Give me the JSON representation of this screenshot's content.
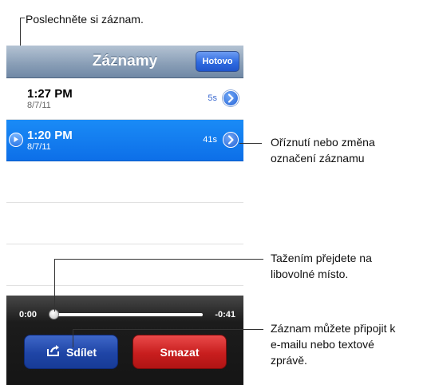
{
  "callouts": {
    "listen": "Poslechněte si záznam.",
    "trim": [
      "Oříznutí nebo změna",
      "označení záznamu"
    ],
    "scrub": [
      "Tažením přejdete na",
      "libovolné místo."
    ],
    "share": [
      "Záznam můžete připojit k",
      "e-mailu nebo textové",
      "zprávě."
    ]
  },
  "navbar": {
    "title": "Záznamy",
    "done_label": "Hotovo"
  },
  "recordings": [
    {
      "time": "1:27 PM",
      "date": "8/7/11",
      "duration": "5s",
      "selected": false
    },
    {
      "time": "1:20 PM",
      "date": "8/7/11",
      "duration": "41s",
      "selected": true
    }
  ],
  "player": {
    "elapsed": "0:00",
    "remaining": "-0:41",
    "progress": 0.0
  },
  "buttons": {
    "share_label": "Sdílet",
    "delete_label": "Smazat"
  },
  "icons": {
    "play": "play-icon",
    "disclosure": "chevron-right-icon",
    "share": "share-arrow-icon"
  }
}
